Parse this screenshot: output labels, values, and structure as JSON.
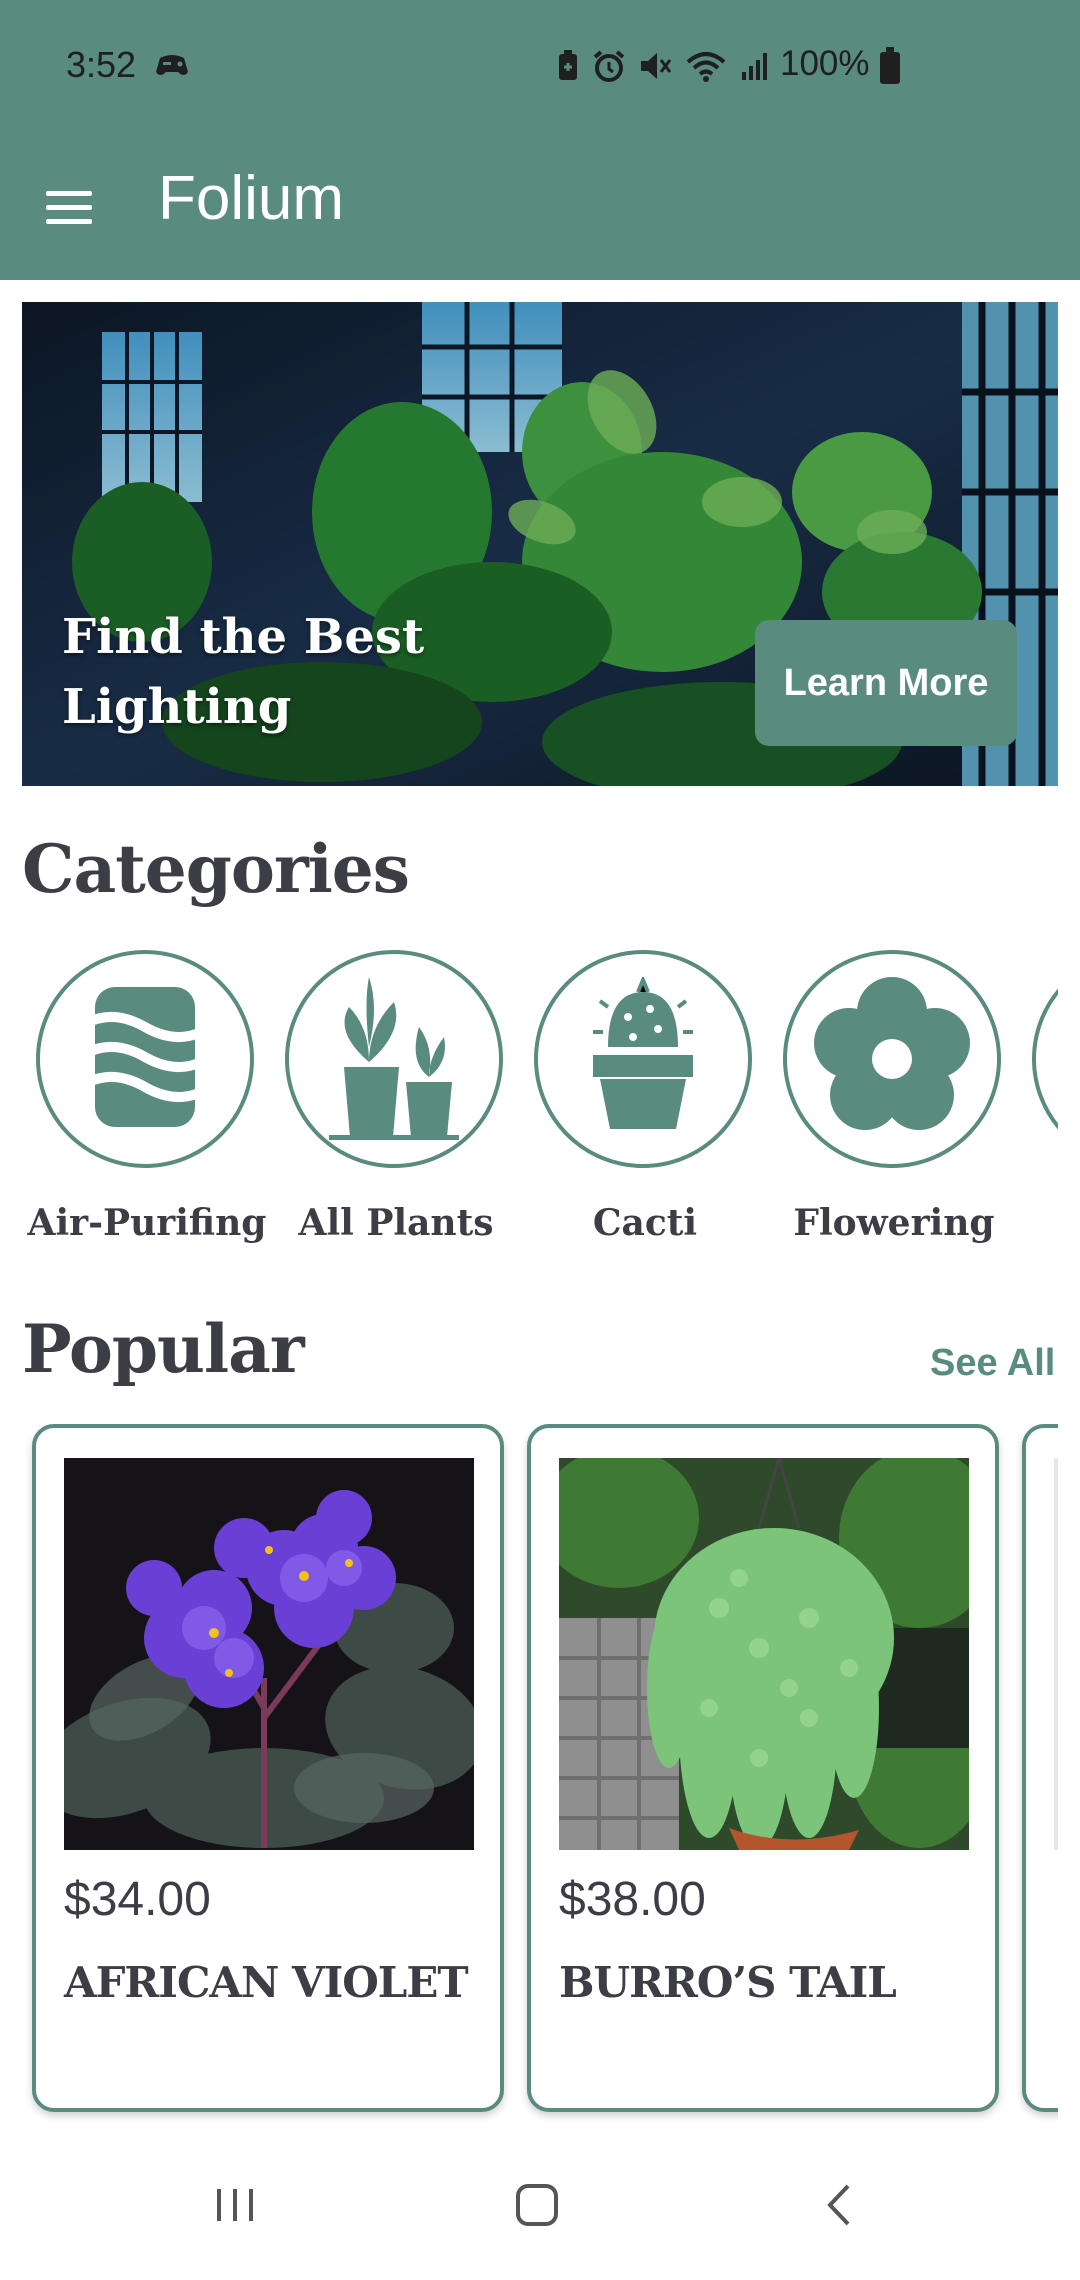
{
  "status": {
    "time": "3:52",
    "battery": "100%",
    "icons": [
      "game-controller-icon",
      "battery-saver-icon",
      "alarm-icon",
      "mute-icon",
      "wifi-icon",
      "signal-icon",
      "battery-icon"
    ]
  },
  "appbar": {
    "title": "Folium",
    "menu_icon": "hamburger-menu-icon"
  },
  "banner": {
    "title": "Find the Best Lighting",
    "button_label": "Learn More"
  },
  "categories": {
    "title": "Categories",
    "items": [
      {
        "label": "Air-Purifing",
        "icon": "air-purifying-icon"
      },
      {
        "label": "All Plants",
        "icon": "potted-plants-icon"
      },
      {
        "label": "Cacti",
        "icon": "cactus-icon"
      },
      {
        "label": "Flowering",
        "icon": "flower-icon"
      },
      {
        "label": "",
        "icon": "category-icon"
      }
    ]
  },
  "popular": {
    "title": "Popular",
    "see_all": "See All",
    "products": [
      {
        "price": "$34.00",
        "name": "AFRICAN VIOLET"
      },
      {
        "price": "$38.00",
        "name": "BURRO’S TAIL"
      }
    ]
  },
  "navbar": {
    "icons": [
      "recent-apps-icon",
      "home-icon",
      "back-icon"
    ]
  },
  "colors": {
    "primary": "#5a8b7f",
    "text": "#3d3d45",
    "white": "#ffffff"
  }
}
